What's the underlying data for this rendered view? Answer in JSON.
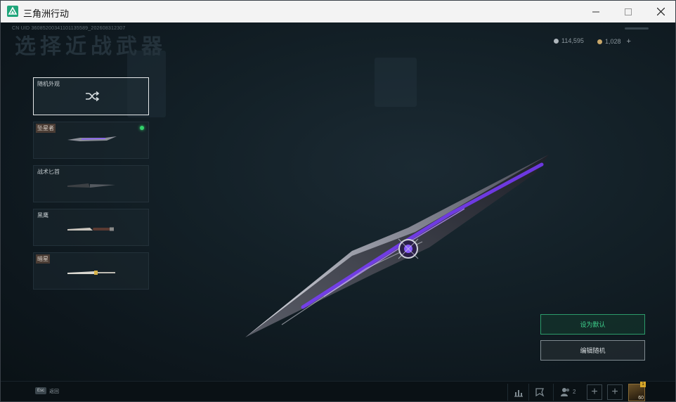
{
  "window": {
    "title": "三角洲行动",
    "icons": [
      "app-logo-icon",
      "minimize-icon",
      "maximize-icon",
      "close-icon"
    ]
  },
  "header": {
    "uid_text": "CN UID 3608520034110113558​9_202608312307",
    "heading": "选择近战武器",
    "currencies": [
      {
        "icon": "silver-coin-icon",
        "value": "114,595"
      },
      {
        "icon": "gold-coin-icon",
        "value": "1,028"
      }
    ],
    "add_label": "+"
  },
  "weapons": [
    {
      "label": "随机外观",
      "icon": "shuffle-icon",
      "selected": true
    },
    {
      "label": "坠星者",
      "icon": "knife-icon",
      "equipped": true
    },
    {
      "label": "战术匕首",
      "icon": "knife-icon"
    },
    {
      "label": "黑鹰",
      "icon": "knife-icon"
    },
    {
      "label": "暗星",
      "icon": "knife-icon"
    }
  ],
  "actions": {
    "set_default": "设为默认",
    "edit_random": "编辑随机"
  },
  "bottom_bar": {
    "esc_key": "Esc",
    "esc_label": "返回",
    "friend_count": "2",
    "avatar_level": "60",
    "avatar_badge": "1",
    "icons": [
      "stats-icon",
      "emote-icon",
      "friends-icon",
      "plus-icon",
      "plus-icon",
      "avatar-icon"
    ]
  },
  "colors": {
    "accent_green": "#3fd38e",
    "equipped_dot": "#33d36b",
    "blade_purple": "#7a3cff"
  }
}
